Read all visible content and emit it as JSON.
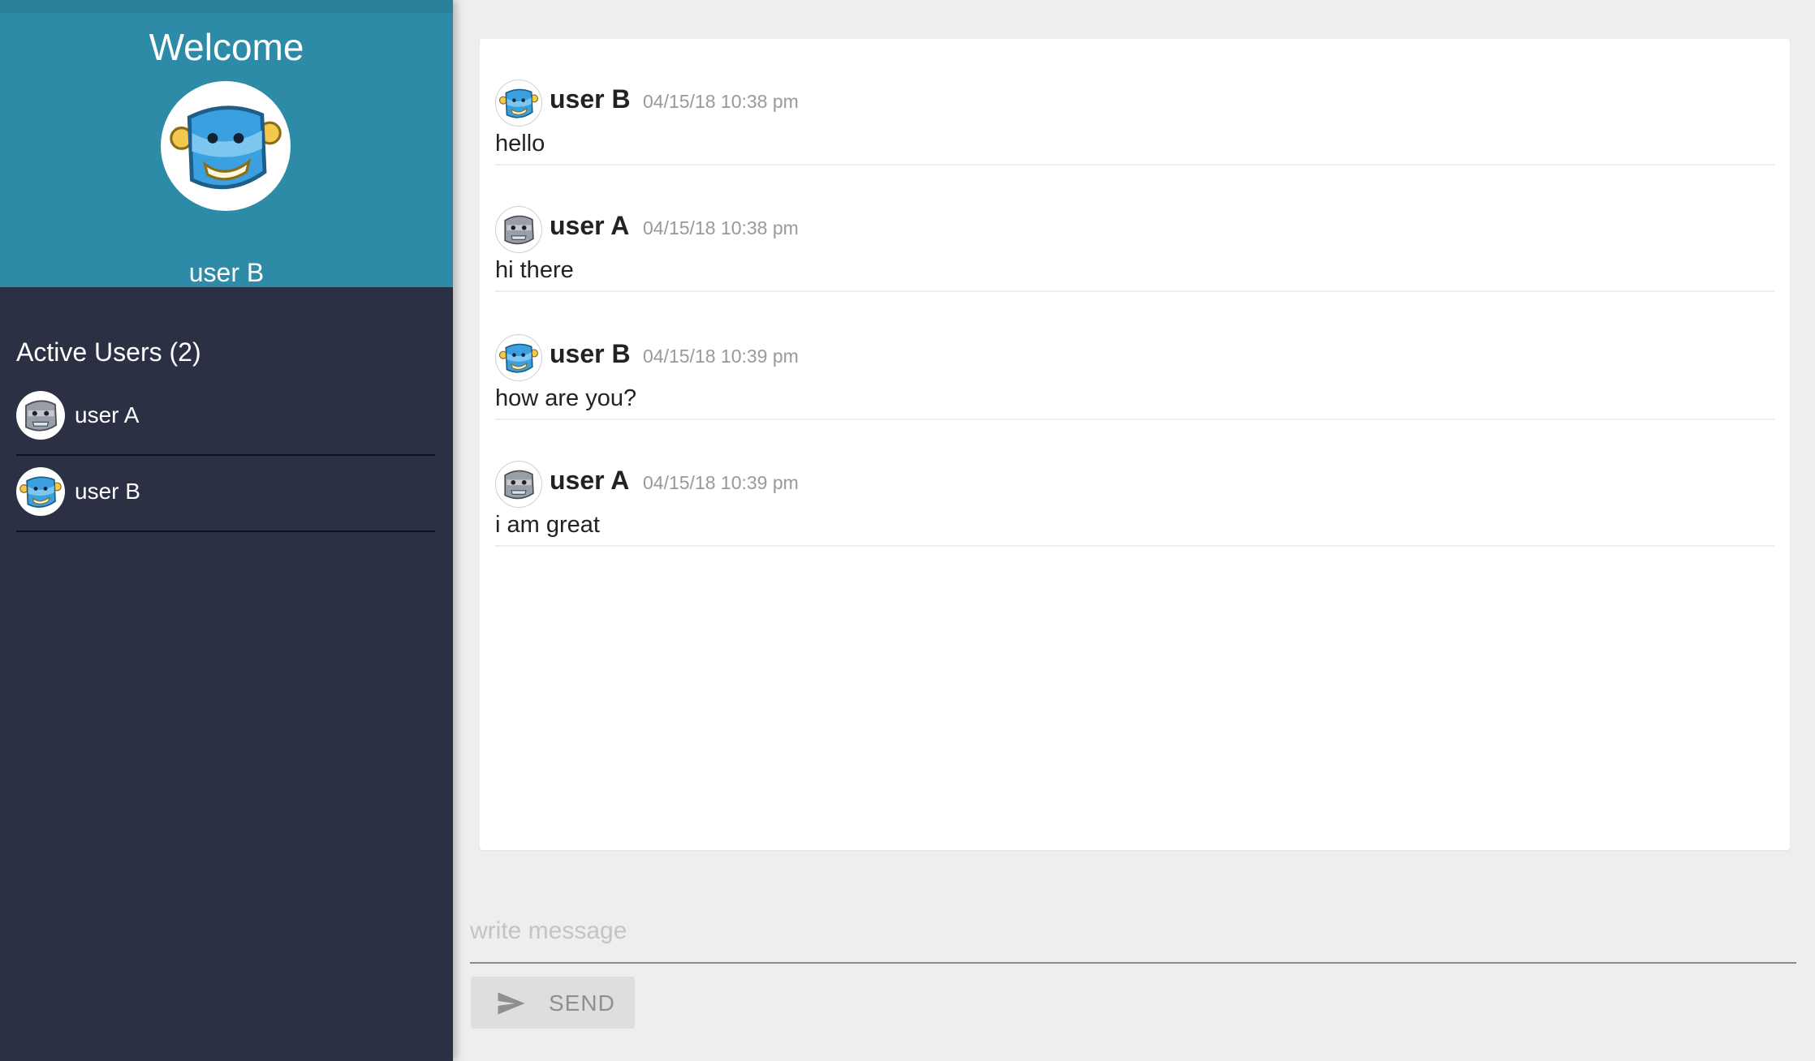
{
  "sidebar": {
    "welcome_title": "Welcome",
    "current_user": {
      "name": "user B",
      "avatar_icon": "blue-robot-avatar-icon"
    },
    "active_users_title": "Active Users (2)",
    "active_users": [
      {
        "name": "user A",
        "avatar_icon": "gray-robot-avatar-icon"
      },
      {
        "name": "user B",
        "avatar_icon": "blue-robot-avatar-icon"
      }
    ]
  },
  "chat": {
    "messages": [
      {
        "author": "user B",
        "time": "04/15/18 10:38 pm",
        "text": "hello",
        "avatar_icon": "blue-robot-avatar-icon"
      },
      {
        "author": "user A",
        "time": "04/15/18 10:38 pm",
        "text": "hi there",
        "avatar_icon": "gray-robot-avatar-icon"
      },
      {
        "author": "user B",
        "time": "04/15/18 10:39 pm",
        "text": "how are you?",
        "avatar_icon": "blue-robot-avatar-icon"
      },
      {
        "author": "user A",
        "time": "04/15/18 10:39 pm",
        "text": "i am great",
        "avatar_icon": "gray-robot-avatar-icon"
      }
    ]
  },
  "composer": {
    "placeholder": "write message",
    "value": "",
    "send_label": "SEND",
    "send_icon": "send-icon"
  },
  "colors": {
    "sidebar_bg": "#2b3044",
    "profile_bg": "#2d8ba8",
    "page_bg": "#eeeeee",
    "timestamp": "#999999"
  }
}
